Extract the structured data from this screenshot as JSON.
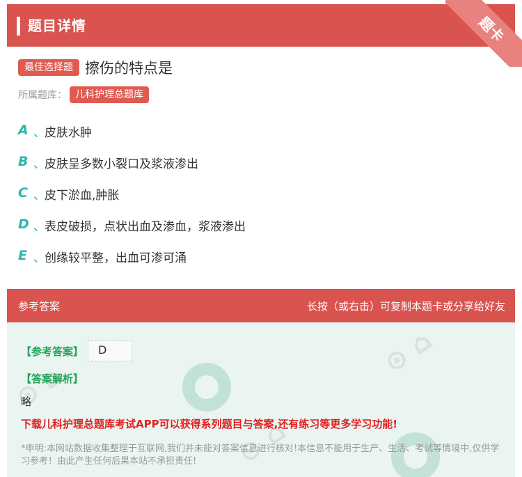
{
  "header": {
    "title": "题目详情",
    "corner_label": "题卡"
  },
  "question": {
    "type_tag": "最佳选择题",
    "text": "擦伤的特点是",
    "bank_label": "所属题库：",
    "bank_name": "儿科护理总题库"
  },
  "options": [
    {
      "letter": "A",
      "sep": "、",
      "text": "皮肤水肿"
    },
    {
      "letter": "B",
      "sep": "、",
      "text": "皮肤呈多数小裂口及浆液渗出"
    },
    {
      "letter": "C",
      "sep": "、",
      "text": "皮下淤血,肿胀"
    },
    {
      "letter": "D",
      "sep": "、",
      "text": "表皮破损，点状出血及渗血，浆液渗出"
    },
    {
      "letter": "E",
      "sep": "、",
      "text": "创缘较平整，出血可渗可涌"
    }
  ],
  "answer_section": {
    "head_left": "参考答案",
    "head_right": "长按（或右击）可复制本题卡或分享给好友",
    "answer_label": "【参考答案】",
    "answer_value": "D",
    "analysis_label": "【答案解析】",
    "analysis_text": "略",
    "promo": "下载儿科护理总题库考试APP可以获得系列题目与答案,还有练习等更多学习功能!",
    "disclaimer": "*申明:本网站数据收集整理于互联网,我们并未能对答案信息进行核对!本信息不能用于生产、生活、考试等情境中,仅供学习参考！由此产生任何后果本站不承担责任!"
  },
  "colors": {
    "accent": "#d9534f",
    "option_letter": "#2bb5b0",
    "answer_green": "#23a35a",
    "promo_red": "#e02020"
  }
}
